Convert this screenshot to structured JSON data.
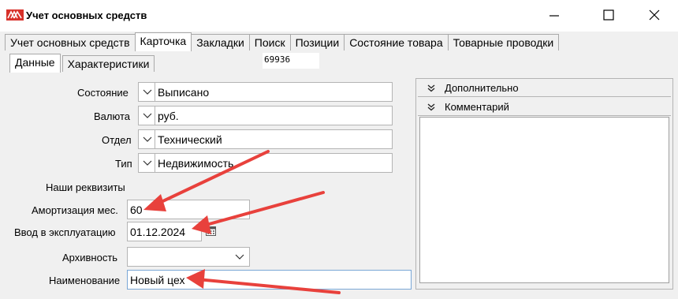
{
  "window": {
    "title": "Учет основных средств",
    "app_icon": "app-logo-icon",
    "controls": {
      "minimize": "minimize-icon",
      "maximize": "maximize-icon",
      "close": "close-icon"
    }
  },
  "tabs_main": [
    {
      "label": "Учет основных средств",
      "active": false
    },
    {
      "label": "Карточка",
      "active": true
    },
    {
      "label": "Закладки",
      "active": false
    },
    {
      "label": "Поиск",
      "active": false
    },
    {
      "label": "Позиции",
      "active": false
    },
    {
      "label": "Состояние товара",
      "active": false
    },
    {
      "label": "Товарные проводки",
      "active": false
    }
  ],
  "tabs_sub": [
    {
      "label": "Данные",
      "active": true
    },
    {
      "label": "Характеристики",
      "active": false
    }
  ],
  "record_id": "69936",
  "form": {
    "state": {
      "label": "Состояние",
      "value": "Выписано"
    },
    "currency": {
      "label": "Валюта",
      "value": "руб."
    },
    "department": {
      "label": "Отдел",
      "value": "Технический"
    },
    "type": {
      "label": "Тип",
      "value": "Недвижимость"
    },
    "section_title": "Наши реквизиты",
    "amortization": {
      "label": "Амортизация мес.",
      "value": "60"
    },
    "commission_date": {
      "label": "Ввод в эксплуатацию",
      "value": "01.12.2024"
    },
    "archive": {
      "label": "Архивность",
      "value": ""
    },
    "name": {
      "label": "Наименование",
      "value": "Новый цех"
    }
  },
  "right_panel": {
    "additional_header": "Дополнительно",
    "comment_header": "Комментарий"
  },
  "annotation_color": "#e8413c"
}
